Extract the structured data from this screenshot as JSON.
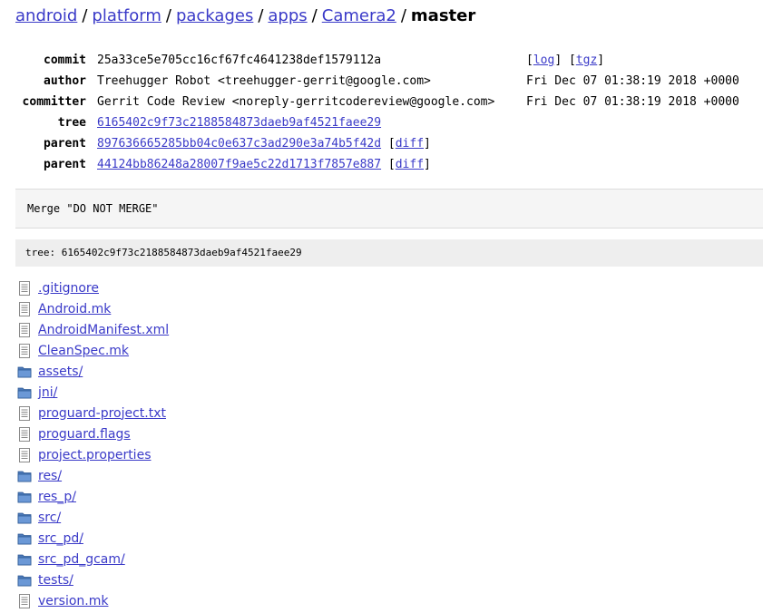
{
  "breadcrumb": {
    "items": [
      "android",
      "platform",
      "packages",
      "apps",
      "Camera2"
    ],
    "separator": "/",
    "current": "master"
  },
  "commit": {
    "commit_label": "commit",
    "commit_hash": "25a33ce5e705cc16cf67fc4641238def1579112a",
    "log_link": "log",
    "tgz_link": "tgz",
    "bracket_open": "[",
    "bracket_close": "]",
    "author_label": "author",
    "author": "Treehugger Robot <treehugger-gerrit@google.com>",
    "author_date": "Fri Dec 07 01:38:19 2018 +0000",
    "committer_label": "committer",
    "committer": "Gerrit Code Review <noreply-gerritcodereview@google.com>",
    "committer_date": "Fri Dec 07 01:38:19 2018 +0000",
    "tree_label": "tree",
    "tree_hash": "6165402c9f73c2188584873daeb9af4521faee29",
    "parent_label": "parent",
    "parent1": "897636665285bb04c0e637c3ad290e3a74b5f42d",
    "parent2": "44124bb86248a28007f9ae5c22d1713f7857e887",
    "diff_link": "diff"
  },
  "message": "Merge \"DO NOT MERGE\"",
  "tree_line": "tree: 6165402c9f73c2188584873daeb9af4521faee29",
  "files": [
    {
      "name": ".gitignore",
      "type": "file"
    },
    {
      "name": "Android.mk",
      "type": "file"
    },
    {
      "name": "AndroidManifest.xml",
      "type": "file"
    },
    {
      "name": "CleanSpec.mk",
      "type": "file"
    },
    {
      "name": "assets/",
      "type": "folder"
    },
    {
      "name": "jni/",
      "type": "folder"
    },
    {
      "name": "proguard-project.txt",
      "type": "file"
    },
    {
      "name": "proguard.flags",
      "type": "file"
    },
    {
      "name": "project.properties",
      "type": "file"
    },
    {
      "name": "res/",
      "type": "folder"
    },
    {
      "name": "res_p/",
      "type": "folder"
    },
    {
      "name": "src/",
      "type": "folder"
    },
    {
      "name": "src_pd/",
      "type": "folder"
    },
    {
      "name": "src_pd_gcam/",
      "type": "folder"
    },
    {
      "name": "tests/",
      "type": "folder"
    },
    {
      "name": "version.mk",
      "type": "file"
    }
  ],
  "colors": {
    "link": "#3a3ac8",
    "folder_icon": "#4a78b8",
    "file_icon": "#8a8a8a"
  }
}
